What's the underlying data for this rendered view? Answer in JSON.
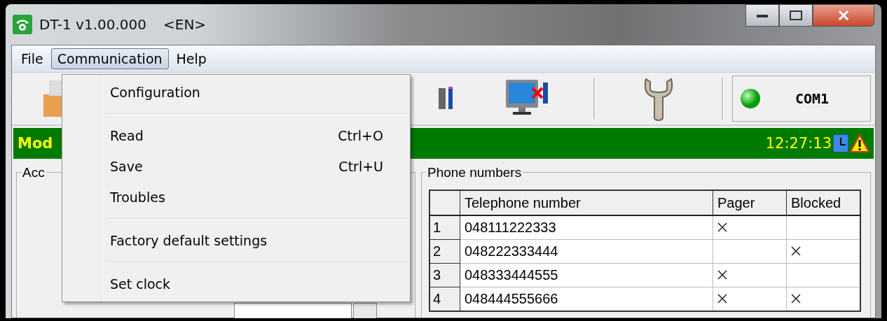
{
  "window": {
    "title": "DT-1 v1.00.000",
    "language": "<EN>"
  },
  "menu_bar": [
    {
      "label": "File",
      "selected": false
    },
    {
      "label": "Communication",
      "selected": true
    },
    {
      "label": "Help",
      "selected": false
    }
  ],
  "dropdown": [
    {
      "kind": "item",
      "label": "Configuration"
    },
    {
      "kind": "separator"
    },
    {
      "kind": "item",
      "label": "Read",
      "shortcut": "Ctrl+O"
    },
    {
      "kind": "item",
      "label": "Save",
      "shortcut": "Ctrl+U"
    },
    {
      "kind": "item",
      "label": "Troubles"
    },
    {
      "kind": "separator"
    },
    {
      "kind": "item",
      "label": "Factory default settings"
    },
    {
      "kind": "separator"
    },
    {
      "kind": "item",
      "label": "Set clock"
    }
  ],
  "toolbar": {
    "port": "COM1",
    "connected": true
  },
  "status_bar": {
    "module_label": "Mod",
    "time": "12:27:13"
  },
  "left_panel": {
    "group_label": "Acc"
  },
  "phone_numbers": {
    "title": "Phone numbers",
    "columns": [
      "Telephone number",
      "Pager",
      "Blocked"
    ],
    "rows": [
      {
        "index": "1",
        "number": "048111222333",
        "pager": true,
        "blocked": false
      },
      {
        "index": "2",
        "number": "048222333444",
        "pager": false,
        "blocked": true
      },
      {
        "index": "3",
        "number": "048333444555",
        "pager": true,
        "blocked": false
      },
      {
        "index": "4",
        "number": "048444555666",
        "pager": true,
        "blocked": true
      }
    ]
  }
}
